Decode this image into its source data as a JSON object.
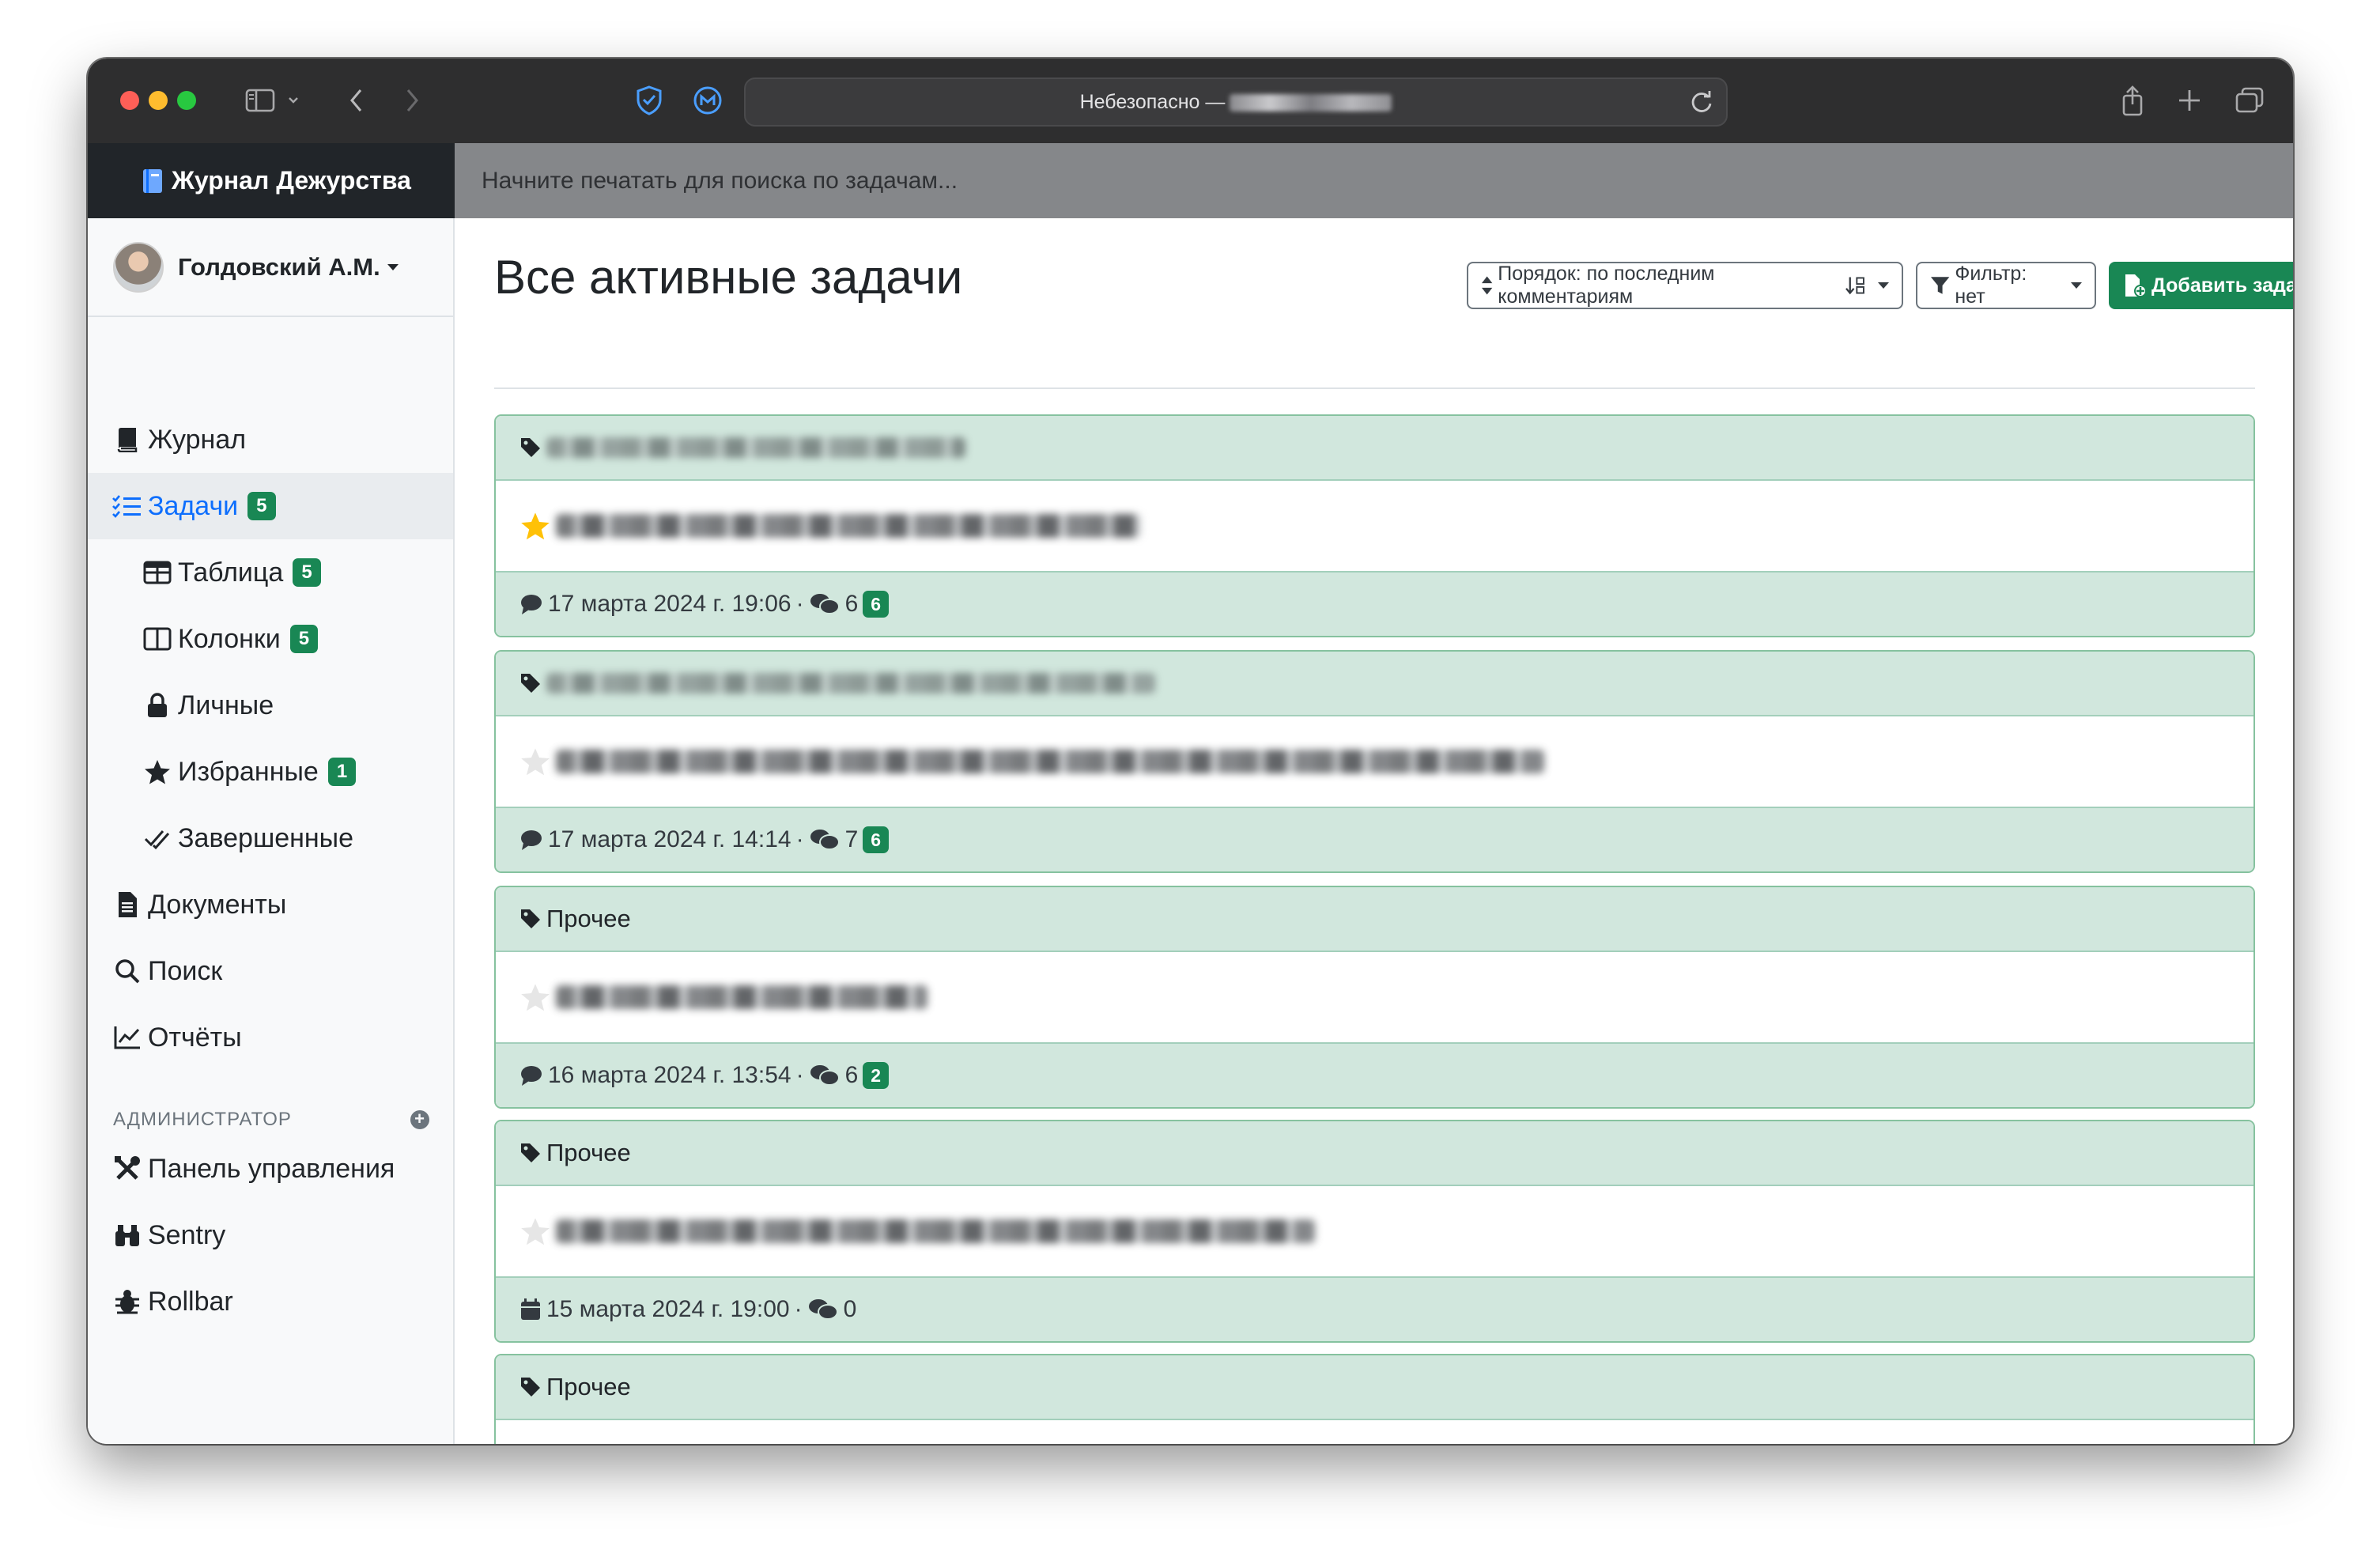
{
  "browser": {
    "address": "Небезопасно —"
  },
  "app": {
    "brand": "Журнал Дежурства",
    "search_placeholder": "Начните печатать для поиска по задачам...",
    "user_name": "Голдовский А.М."
  },
  "sidebar": {
    "items": [
      {
        "label": "Журнал",
        "icon": "book-icon"
      },
      {
        "label": "Задачи",
        "icon": "list-check-icon",
        "badge": "5",
        "active": true
      },
      {
        "label": "Таблица",
        "icon": "table-icon",
        "badge": "5"
      },
      {
        "label": "Колонки",
        "icon": "columns-icon",
        "badge": "5"
      },
      {
        "label": "Личные",
        "icon": "lock-icon"
      },
      {
        "label": "Избранные",
        "icon": "star-icon",
        "badge": "1"
      },
      {
        "label": "Завершенные",
        "icon": "check-double-icon"
      },
      {
        "label": "Документы",
        "icon": "file-icon"
      },
      {
        "label": "Поиск",
        "icon": "search-icon"
      },
      {
        "label": "Отчёты",
        "icon": "chart-line-icon"
      }
    ],
    "admin_header": "АДМИНИСТРАТОР",
    "admin_items": [
      {
        "label": "Панель управления",
        "icon": "tools-icon"
      },
      {
        "label": "Sentry",
        "icon": "binoculars-icon"
      },
      {
        "label": "Rollbar",
        "icon": "bug-icon"
      }
    ]
  },
  "main": {
    "title": "Все активные задачи",
    "order_button": "Порядок: по последним комментариям",
    "filter_button": "Фильтр: нет",
    "add_button": "Добавить задачу"
  },
  "tasks": [
    {
      "category": "",
      "starred": true,
      "date": "17 марта 2024 г. 19:06",
      "date_icon": "comment-icon",
      "comments": "6",
      "new": "6"
    },
    {
      "category": "",
      "starred": false,
      "date": "17 марта 2024 г. 14:14",
      "date_icon": "comment-icon",
      "comments": "7",
      "new": "6"
    },
    {
      "category": "Прочее",
      "starred": false,
      "date": "16 марта 2024 г. 13:54",
      "date_icon": "comment-icon",
      "comments": "6",
      "new": "2"
    },
    {
      "category": "Прочее",
      "starred": false,
      "date": "15 марта 2024 г. 19:00",
      "date_icon": "calendar-icon",
      "comments": "0",
      "new": ""
    },
    {
      "category": "Прочее",
      "starred": false,
      "date": "",
      "date_icon": "",
      "comments": "",
      "new": ""
    }
  ],
  "colors": {
    "brand_bg": "#212529",
    "accent": "#0d6efd",
    "success": "#198754",
    "card_header_bg": "#d1e7dd",
    "star_active": "#ffc107"
  }
}
